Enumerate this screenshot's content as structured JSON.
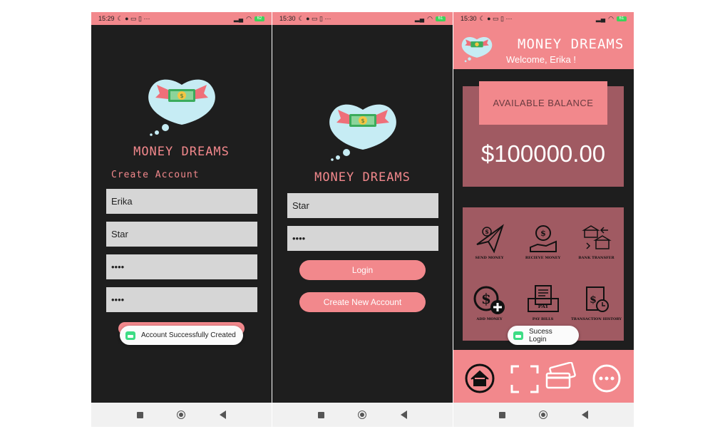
{
  "screens": [
    {
      "status": {
        "time": "15:29",
        "battery": "62"
      },
      "brand": "MONEY DREAMS",
      "subtitle": "Create Account",
      "fields": [
        {
          "value": "Erika"
        },
        {
          "value": "Star"
        },
        {
          "value": "••••"
        },
        {
          "value": "••••"
        }
      ],
      "toast": "Account Successfully Created"
    },
    {
      "status": {
        "time": "15:30",
        "battery": "61"
      },
      "brand": "MONEY DREAMS",
      "fields": [
        {
          "value": "Star"
        },
        {
          "value": "••••"
        }
      ],
      "login_label": "Login",
      "create_label": "Create New Account"
    },
    {
      "status": {
        "time": "15:30",
        "battery": "61"
      },
      "brand": "MONEY DREAMS",
      "welcome": "Welcome, Erika !",
      "balance_label": "AVAILABLE BALANCE",
      "balance_value": "$100000.00",
      "actions": [
        {
          "label": "SEND MONEY",
          "icon": "send-money-icon"
        },
        {
          "label": "RECIEVE MONEY",
          "icon": "receive-money-icon"
        },
        {
          "label": "BANK TRANSFER",
          "icon": "bank-transfer-icon"
        },
        {
          "label": "ADD MONEY",
          "icon": "add-money-icon"
        },
        {
          "label": "PAY BILLS",
          "icon": "pay-bills-icon"
        },
        {
          "label": "TRANSACTION HISTORY",
          "icon": "transaction-history-icon"
        }
      ],
      "toast": "Sucess Login",
      "bottom_nav": [
        "home-icon",
        "scan-icon",
        "cards-icon",
        "more-icon"
      ]
    }
  ],
  "colors": {
    "accent": "#f2888c",
    "dark": "#1e1e1e",
    "panel": "#a05a62"
  }
}
